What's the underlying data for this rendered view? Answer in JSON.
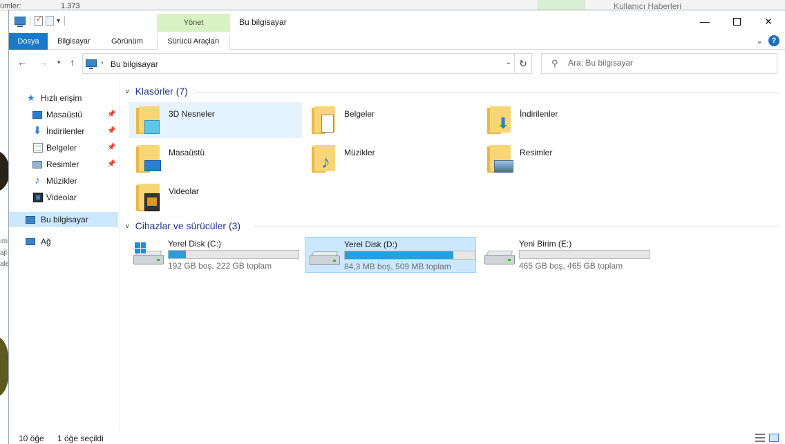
{
  "background": {
    "left_label": "ümler:",
    "left_count": "1.373",
    "news_title": "Kullanıcı Haberleri",
    "side_text": [
      "ım",
      "ajl",
      "ale"
    ]
  },
  "window": {
    "title": "Bu bilgisayar",
    "contextual_tab": "Yönet"
  },
  "ribbon": {
    "tabs": {
      "file": "Dosya",
      "computer": "Bilgisayar",
      "view": "Görünüm",
      "drive_tools": "Sürücü Araçları"
    },
    "help": "?"
  },
  "address": {
    "crumb": "Bu bilgisayar",
    "search_placeholder": "Ara: Bu bilgisayar"
  },
  "sidebar": {
    "items": [
      {
        "label": "Hızlı erişim",
        "icon": "star-icon"
      },
      {
        "label": "Masaüstü",
        "icon": "desktop-icon",
        "pinned": true
      },
      {
        "label": "İndirilenler",
        "icon": "downloads-icon",
        "pinned": true
      },
      {
        "label": "Belgeler",
        "icon": "documents-icon",
        "pinned": true
      },
      {
        "label": "Resimler",
        "icon": "pictures-icon",
        "pinned": true
      },
      {
        "label": "Müzikler",
        "icon": "music-icon"
      },
      {
        "label": "Videolar",
        "icon": "videos-icon"
      },
      {
        "label": "Bu bilgisayar",
        "icon": "computer-icon",
        "selected": true
      },
      {
        "label": "Ağ",
        "icon": "network-icon"
      }
    ]
  },
  "content": {
    "folders_header": "Klasörler (7)",
    "folders": [
      {
        "name": "3D Nesneler",
        "highlighted": true
      },
      {
        "name": "Belgeler"
      },
      {
        "name": "İndirilenler"
      },
      {
        "name": "Masaüstü"
      },
      {
        "name": "Müzikler"
      },
      {
        "name": "Resimler"
      },
      {
        "name": "Videolar"
      }
    ],
    "devices_header": "Cihazlar ve sürücüler (3)",
    "drives": [
      {
        "name": "Yerel Disk (C:)",
        "info": "192 GB boş, 222 GB toplam",
        "used_fraction": 0.135,
        "system": true
      },
      {
        "name": "Yerel Disk (D:)",
        "info": "84,3 MB boş, 509 MB toplam",
        "used_fraction": 0.834,
        "selected": true
      },
      {
        "name": "Yeni Birim (E:)",
        "info": "465 GB boş, 465 GB toplam",
        "used_fraction": 0.0
      }
    ]
  },
  "status": {
    "items": "10 öğe",
    "selected": "1 öğe seçildi"
  },
  "colors": {
    "accent": "#1979ca",
    "drive_bar": "#26a0da",
    "selection": "#cce8ff",
    "manage_tab": "#d9f2c2",
    "group_header": "#1e3287"
  }
}
